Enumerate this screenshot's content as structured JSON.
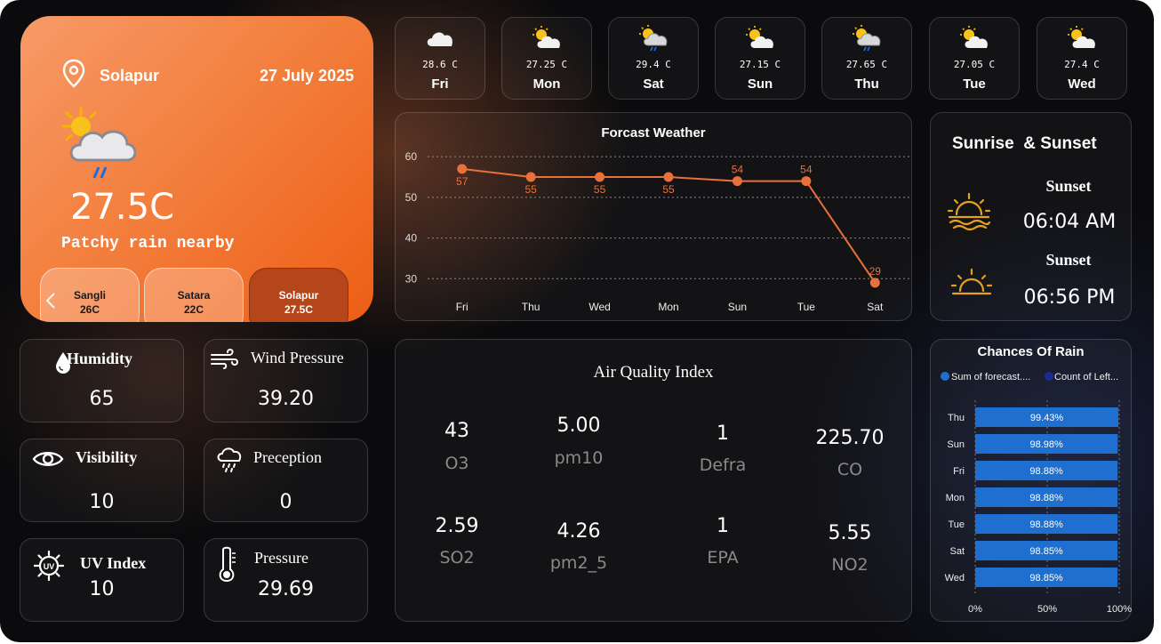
{
  "hero": {
    "city": "Solapur",
    "date": "27 July 2025",
    "temperature": "27.5C",
    "condition": "Patchy rain nearby",
    "cities": [
      {
        "name": "Sangli",
        "temp": "26C",
        "active": false
      },
      {
        "name": "Satara",
        "temp": "22C",
        "active": false
      },
      {
        "name": "Solapur",
        "temp": "27.5C",
        "active": true
      }
    ]
  },
  "metrics": {
    "humidity": {
      "label": "Humidity",
      "value": "65",
      "icon": "droplet-icon"
    },
    "wind_pressure": {
      "label": "Wind Pressure",
      "value": "39.20",
      "icon": "wind-icon"
    },
    "visibility": {
      "label": "Visibility",
      "value": "10",
      "icon": "eye-icon"
    },
    "preception": {
      "label": "Preception",
      "value": "0",
      "icon": "rain-cloud-icon"
    },
    "uv_index": {
      "label": "UV Index",
      "value": "10",
      "icon": "uv-sun-icon"
    },
    "pressure": {
      "label": "Pressure",
      "value": "29.69",
      "icon": "thermometer-icon"
    }
  },
  "days": [
    {
      "day": "Fri",
      "temp": "28.6 C",
      "icon": "cloud-icon"
    },
    {
      "day": "Mon",
      "temp": "27.25 C",
      "icon": "partly-cloudy-icon"
    },
    {
      "day": "Sat",
      "temp": "29.4 C",
      "icon": "partly-cloudy-rain-icon"
    },
    {
      "day": "Sun",
      "temp": "27.15 C",
      "icon": "partly-cloudy-icon"
    },
    {
      "day": "Thu",
      "temp": "27.65 C",
      "icon": "partly-cloudy-rain-icon"
    },
    {
      "day": "Tue",
      "temp": "27.05 C",
      "icon": "partly-cloudy-icon"
    },
    {
      "day": "Wed",
      "temp": "27.4 C",
      "icon": "partly-cloudy-icon"
    }
  ],
  "sun": {
    "title": "Sunrise  & Sunset",
    "sunrise_label": "Sunset",
    "sunrise_time": "06:04 AM",
    "sunset_label": "Sunset",
    "sunset_time": "06:56 PM"
  },
  "air_quality": {
    "title": "Air Quality Index",
    "items": [
      {
        "value": "43",
        "label": "O3"
      },
      {
        "value": "5.00",
        "label": "pm10"
      },
      {
        "value": "1",
        "label": "Defra"
      },
      {
        "value": "225.70",
        "label": "CO"
      },
      {
        "value": "2.59",
        "label": "SO2"
      },
      {
        "value": "4.26",
        "label": "pm2_5"
      },
      {
        "value": "1",
        "label": "EPA"
      },
      {
        "value": "5.55",
        "label": "NO2"
      }
    ]
  },
  "chart_data": [
    {
      "type": "line",
      "title": "Forcast Weather",
      "categories": [
        "Fri",
        "Thu",
        "Wed",
        "Mon",
        "Sun",
        "Tue",
        "Sat"
      ],
      "values": [
        57,
        55,
        55,
        55,
        54,
        54,
        29
      ],
      "data_labels": [
        "57",
        "55",
        "55",
        "55",
        "54",
        "54",
        "29"
      ],
      "yticks": [
        30,
        40,
        50,
        60
      ],
      "ylim": [
        27,
        62
      ],
      "color": "#e8703a",
      "grid": true
    },
    {
      "type": "bar",
      "orientation": "horizontal",
      "title": "Chances Of Rain",
      "legend": [
        "Sum of forecast....",
        "Count of Left..."
      ],
      "legend_colors": [
        "#1f6fd1",
        "#1b2d8f"
      ],
      "categories": [
        "Thu",
        "Sun",
        "Fri",
        "Mon",
        "Tue",
        "Sat",
        "Wed"
      ],
      "values": [
        99.43,
        98.98,
        98.88,
        98.88,
        98.88,
        98.85,
        98.85
      ],
      "value_labels": [
        "99.43%",
        "98.98%",
        "98.88%",
        "98.88%",
        "98.88%",
        "98.85%",
        "98.85%"
      ],
      "xticks": [
        "0%",
        "50%",
        "100%"
      ],
      "xlim": [
        0,
        100
      ],
      "color": "#1e6fd0",
      "legend_position": "top-left"
    }
  ]
}
